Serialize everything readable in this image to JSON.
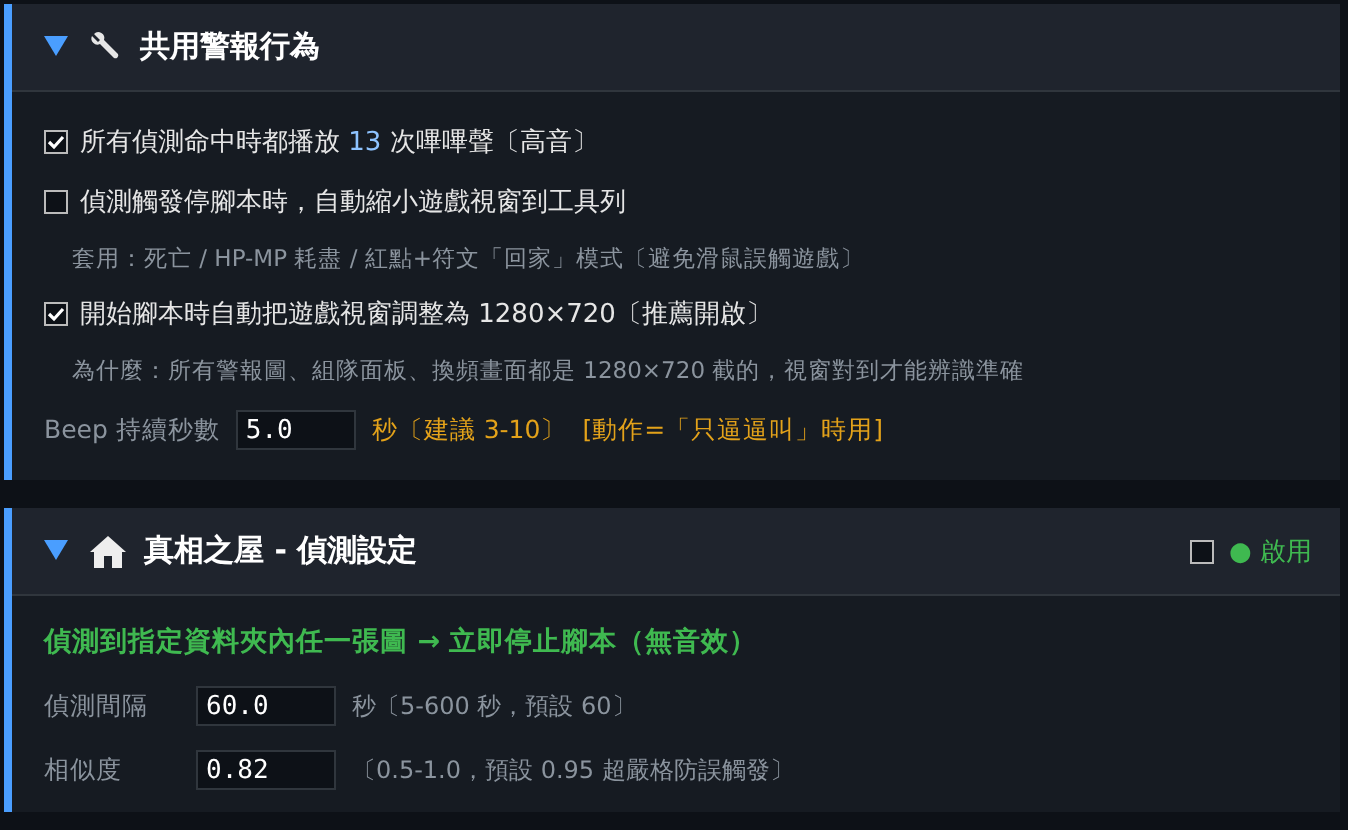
{
  "panels": [
    {
      "title": "共用警報行為",
      "expanded": true,
      "options": [
        {
          "kind": "check",
          "checked": true,
          "label_before": "所有偵測命中時都播放",
          "count": "13",
          "label_after": "次嗶嗶聲〔高音〕"
        },
        {
          "kind": "check",
          "checked": false,
          "label": "偵測觸發停腳本時，自動縮小遊戲視窗到工具列"
        },
        {
          "kind": "note",
          "text": "套用：死亡 / HP-MP 耗盡 / 紅點+符文「回家」模式〔避免滑鼠誤觸遊戲〕"
        },
        {
          "kind": "check",
          "checked": true,
          "label": "開始腳本時自動把遊戲視窗調整為 1280×720〔推薦開啟〕"
        },
        {
          "kind": "note",
          "text": "為什麼：所有警報圖、組隊面板、換頻畫面都是 1280×720 截的，視窗對到才能辨識準確"
        },
        {
          "kind": "field",
          "label": "Beep 持續秒數",
          "value": "5.0",
          "hint": "秒〔建議 3-10〕",
          "extra": "[動作=「只逼逼叫」時用]"
        }
      ]
    },
    {
      "title": "真相之屋 - 偵測設定",
      "expanded": true,
      "enable": {
        "checked": false,
        "label": "● 啟用"
      },
      "options": [
        {
          "kind": "headline",
          "text": "偵測到指定資料夾內任一張圖 → 立即停止腳本（無音效）"
        },
        {
          "kind": "row",
          "label": "偵測間隔",
          "value": "60.0",
          "hint": "秒〔5-600 秒，預設 60〕"
        },
        {
          "kind": "row",
          "label": "相似度",
          "value": "0.82",
          "hint": "〔0.5-1.0，預設 0.95 超嚴格防誤觸發〕"
        }
      ]
    }
  ]
}
